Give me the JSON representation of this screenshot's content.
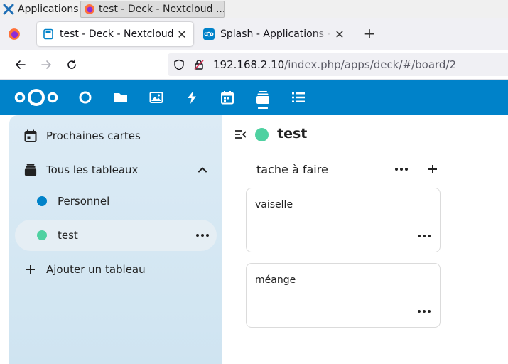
{
  "os_taskbar": {
    "apps_label": "Applications",
    "window_title": "test - Deck - Nextcloud ..."
  },
  "browser": {
    "tabs": [
      {
        "title": "test - Deck - Nextcloud",
        "active": true
      },
      {
        "title": "Splash - Applications - Applications",
        "active": false
      }
    ],
    "url_host": "192.168.2.10",
    "url_path": "/index.php/apps/deck/#/board/2"
  },
  "nextcloud": {
    "brand_color": "#0082c9",
    "apps": [
      "dashboard-icon",
      "files-icon",
      "photos-icon",
      "activity-icon",
      "calendar-icon",
      "deck-icon",
      "tasks-icon"
    ],
    "active_app": "deck-icon"
  },
  "sidebar": {
    "upcoming_label": "Prochaines cartes",
    "all_boards_label": "Tous les tableaux",
    "boards": [
      {
        "label": "Personnel",
        "color": "#0082c9"
      },
      {
        "label": "test",
        "color": "#4fd1a1",
        "selected": true
      }
    ],
    "add_board_label": "Ajouter un tableau"
  },
  "board": {
    "title": "test",
    "color": "#4fd1a1",
    "stack": {
      "title": "tache à faire",
      "cards": [
        {
          "title": "vaiselle"
        },
        {
          "title": "méange"
        }
      ]
    }
  }
}
